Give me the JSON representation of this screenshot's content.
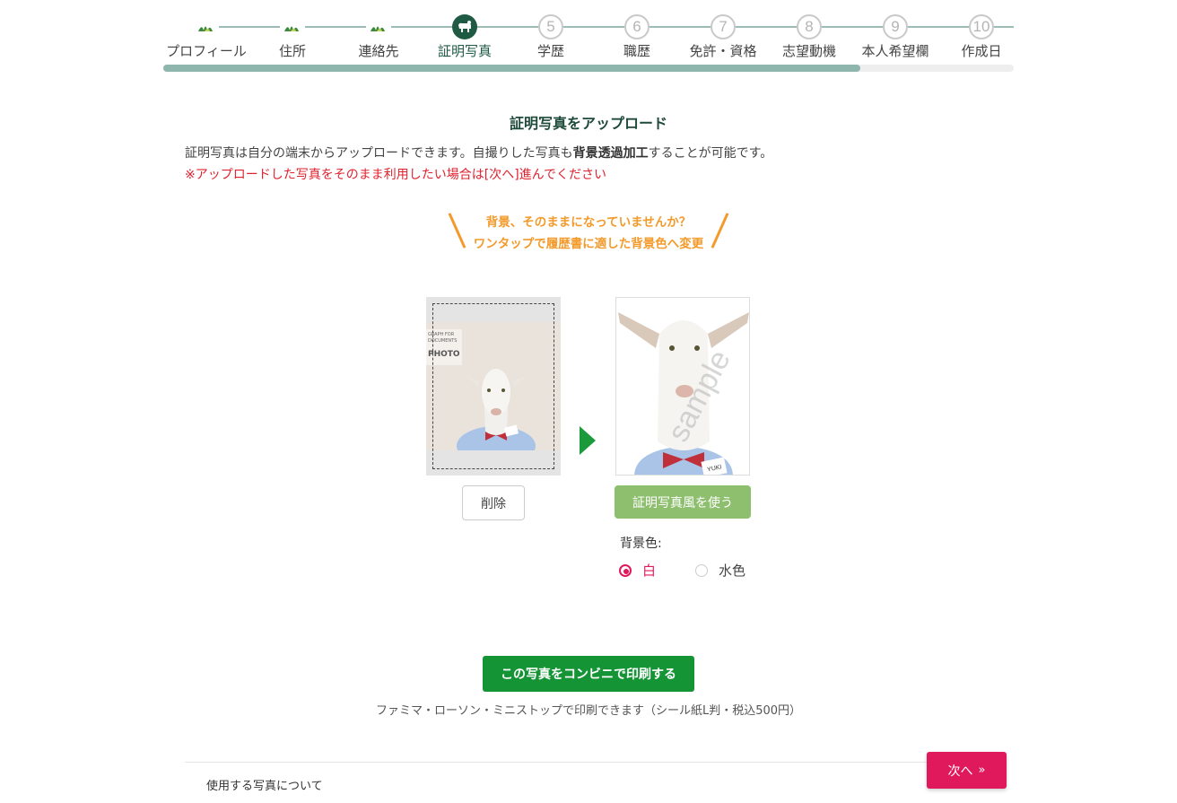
{
  "stepper": {
    "steps": [
      {
        "label": "プロフィール",
        "number": "",
        "state": "done"
      },
      {
        "label": "住所",
        "number": "",
        "state": "done"
      },
      {
        "label": "連絡先",
        "number": "",
        "state": "done"
      },
      {
        "label": "証明写真",
        "number": "",
        "state": "current"
      },
      {
        "label": "学歴",
        "number": "5",
        "state": "todo"
      },
      {
        "label": "職歴",
        "number": "6",
        "state": "todo"
      },
      {
        "label": "免許・資格",
        "number": "7",
        "state": "todo"
      },
      {
        "label": "志望動機",
        "number": "8",
        "state": "todo"
      },
      {
        "label": "本人希望欄",
        "number": "9",
        "state": "todo"
      },
      {
        "label": "作成日",
        "number": "10",
        "state": "todo"
      }
    ],
    "progress_fraction": 0.82
  },
  "main": {
    "title": "証明写真をアップロード",
    "desc_part1": "証明写真は自分の端末からアップロードできます。自撮りした写真も",
    "desc_bold": "背景透過加工",
    "desc_part2": "することが可能です。",
    "warning": "※アップロードした写真をそのまま利用したい場合は[次へ]進んでください",
    "callout_line1": "背景、そのままになっていませんか？",
    "callout_line2": "ワンタップで履歴書に適した背景色へ変更"
  },
  "photos": {
    "sign_text": "GRAPH FOR DOCUMENTS",
    "sign_big": "PHOTO",
    "name_tag": "YUKI",
    "watermark": "sample"
  },
  "actions": {
    "delete_label": "削除",
    "use_idphoto_label": "証明写真風を使う",
    "bg_color_label": "背景色:",
    "bg_options": [
      "白",
      "水色"
    ],
    "bg_selected": "白",
    "print_label": "この写真をコンビニで印刷する",
    "print_note": "ファミマ・ローソン・ミニストップで印刷できます（シール紙L判・税込500円）",
    "about_label": "使用する写真について",
    "next_label": "次へ",
    "next_icon": "double-chevron-right-icon"
  },
  "colors": {
    "brand_dark": "#1e5a44",
    "progress": "#8fb6ad",
    "accent_pink": "#e0185c",
    "print_green": "#159436",
    "idphoto_green": "#8dbf6e",
    "callout_orange": "#f39a2b",
    "warning_red": "#e0222f"
  }
}
